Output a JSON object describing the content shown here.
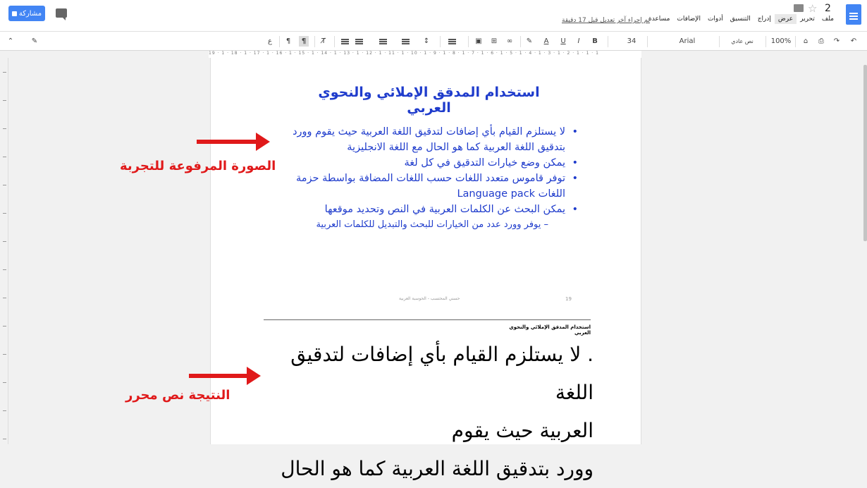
{
  "header": {
    "share_label": "مشاركة",
    "doc_title": "2",
    "last_edit": "تم إجراء آخر تعديل قبل 17 دقيقة",
    "menu": [
      {
        "label": "ملف"
      },
      {
        "label": "تحرير"
      },
      {
        "label": "عرض"
      },
      {
        "label": "إدراج"
      },
      {
        "label": "التنسيق"
      },
      {
        "label": "أدوات"
      },
      {
        "label": "الإضافات"
      },
      {
        "label": "مساعدة"
      }
    ],
    "active_menu": "عرض"
  },
  "toolbar": {
    "zoom": "100%",
    "style": "نص عادي",
    "font": "Arial",
    "font_size": "34",
    "bold": "B",
    "italic": "I",
    "underline": "U",
    "text_color": "A"
  },
  "ruler": {
    "ticks": "19 · 1 · 18 · 1 · 17 · 1 · 16 · 1 · 15 · 1 · 14 · 1 · 13 · 1 · 12 · 1 · 11 · 1 · 10 · 1 · 9 · 1 · 8 · 1 · 7 · 1 · 6 · 1 · 5 · 1 · 4 · 1 · 3 · 1 · 2 · 1 · 1 · 1"
  },
  "document": {
    "image_title": "استخدام المدقق الإملائي والنحوي العربي",
    "bullets": [
      {
        "text": "لا يستلزم القيام بأي إضافات لتدقيق اللغة العربية حيث يقوم وورد بتدقيق اللغة العربية كما هو الحال مع اللغة الانجليزية"
      },
      {
        "text": "يمكن وضع خيارات التدقيق في كل لغة"
      },
      {
        "text": "توفر قاموس متعدد اللغات حسب اللغات المضافة بواسطة حزمة اللغات  Language pack"
      },
      {
        "text": "يمكن البحث عن الكلمات العربية في النص وتحديد موقعها"
      }
    ],
    "sub_bullet": "– يوفر وورد عدد من الخيارات للبحث والتبديل للكلمات العربية",
    "page_number": "19",
    "footer": "حسني المحتسب - الحوسبة العربية",
    "small_heading": "استخدام المدقق الإملائي والنحوي العربي",
    "result_lines": [
      ". لا يستلزم القيام بأي إضافات لتدقيق اللغة",
      "العربية حيث يقوم",
      "وورد بتدقيق اللغة العربية كما هو الحال"
    ]
  },
  "annotations": {
    "uploaded_image": "الصورة المرفوعة للتجربة",
    "result": "النتيجة نص محرر"
  },
  "colors": {
    "share_button": "#4285f4",
    "annotation_red": "#e0191a",
    "image_text_blue": "#1f3ccc"
  }
}
